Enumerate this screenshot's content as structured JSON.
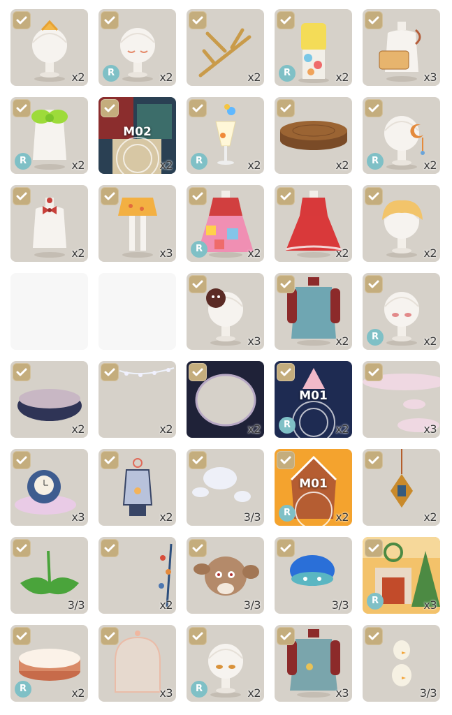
{
  "items": [
    {
      "id": "hair-clip-yellow",
      "count": "x2",
      "rare": false,
      "checked": true,
      "code": null
    },
    {
      "id": "head-eyes-closed",
      "count": "x2",
      "rare": true,
      "checked": true,
      "code": null
    },
    {
      "id": "golden-branch-rack",
      "count": "x2",
      "rare": false,
      "checked": true,
      "code": null
    },
    {
      "id": "yellow-outfit-balloons",
      "count": "x2",
      "rare": true,
      "checked": true,
      "code": null
    },
    {
      "id": "jam-tag-bust",
      "count": "x3",
      "rare": false,
      "checked": true,
      "code": null
    },
    {
      "id": "green-bow-top",
      "count": "x2",
      "rare": true,
      "checked": true,
      "code": null
    },
    {
      "id": "music-disc-m02",
      "count": "x2",
      "rare": false,
      "checked": true,
      "code": "M02"
    },
    {
      "id": "balloon-glass",
      "count": "x2",
      "rare": true,
      "checked": true,
      "code": null
    },
    {
      "id": "wood-stump-platform",
      "count": "x2",
      "rare": false,
      "checked": true,
      "code": null
    },
    {
      "id": "moon-earring-head",
      "count": "x2",
      "rare": true,
      "checked": true,
      "code": null
    },
    {
      "id": "red-bow-top",
      "count": "x2",
      "rare": false,
      "checked": true,
      "code": null
    },
    {
      "id": "yellow-skirt-tights",
      "count": "x3",
      "rare": false,
      "checked": true,
      "code": null
    },
    {
      "id": "patchwork-dress",
      "count": "x2",
      "rare": true,
      "checked": true,
      "code": null
    },
    {
      "id": "red-ruffle-dress",
      "count": "x2",
      "rare": false,
      "checked": true,
      "code": null
    },
    {
      "id": "fluffy-blonde-hair",
      "count": "x2",
      "rare": false,
      "checked": true,
      "code": null
    },
    {
      "id": "blank-1",
      "blank": true
    },
    {
      "id": "blank-2",
      "blank": true
    },
    {
      "id": "button-hairpin",
      "count": "x3",
      "rare": false,
      "checked": true,
      "code": null
    },
    {
      "id": "sweater-dress",
      "count": "x2",
      "rare": false,
      "checked": true,
      "code": null
    },
    {
      "id": "pink-eyes-head",
      "count": "x2",
      "rare": true,
      "checked": true,
      "code": null
    },
    {
      "id": "dark-cloud-floor",
      "count": "x2",
      "rare": false,
      "checked": true,
      "code": null
    },
    {
      "id": "crystal-garland",
      "count": "x2",
      "rare": false,
      "checked": true,
      "code": null
    },
    {
      "id": "dark-ring-frame",
      "count": "x2",
      "rare": false,
      "checked": true,
      "code": null
    },
    {
      "id": "music-disc-m01-blue",
      "count": "x2",
      "rare": true,
      "checked": true,
      "code": "M01"
    },
    {
      "id": "pink-clouds",
      "count": "x3",
      "rare": false,
      "checked": true,
      "code": null
    },
    {
      "id": "snow-globe-clock",
      "count": "x3",
      "rare": false,
      "checked": true,
      "code": null
    },
    {
      "id": "glass-lantern",
      "count": "x2",
      "rare": false,
      "checked": true,
      "code": null
    },
    {
      "id": "soap-bubbles",
      "count": "3/3",
      "rare": false,
      "checked": true,
      "code": null
    },
    {
      "id": "music-disc-m01-gingerbread",
      "count": "x2",
      "rare": true,
      "checked": true,
      "code": "M01"
    },
    {
      "id": "hanging-ornament",
      "count": "x2",
      "rare": false,
      "checked": true,
      "code": null
    },
    {
      "id": "green-leaf",
      "count": "3/3",
      "rare": false,
      "checked": true,
      "code": null
    },
    {
      "id": "berry-branch",
      "count": "x2",
      "rare": false,
      "checked": true,
      "code": null
    },
    {
      "id": "bunny-plush",
      "count": "3/3",
      "rare": false,
      "checked": true,
      "code": null
    },
    {
      "id": "blue-mushroom-hat",
      "count": "3/3",
      "rare": false,
      "checked": true,
      "code": null
    },
    {
      "id": "christmas-fireplace-room",
      "count": "x3",
      "rare": true,
      "checked": true,
      "code": null
    },
    {
      "id": "cream-cake",
      "count": "x2",
      "rare": true,
      "checked": true,
      "code": null
    },
    {
      "id": "glass-dome",
      "count": "x3",
      "rare": false,
      "checked": true,
      "code": null
    },
    {
      "id": "amber-eyes-head",
      "count": "x2",
      "rare": true,
      "checked": true,
      "code": null
    },
    {
      "id": "teal-sweater-dress",
      "count": "x3",
      "rare": false,
      "checked": true,
      "code": null
    },
    {
      "id": "snowman-chicks",
      "count": "3/3",
      "rare": false,
      "checked": true,
      "code": null
    }
  ],
  "badges": {
    "rare_letter": "R"
  },
  "colors": {
    "tile": "#d6d1c9",
    "check": "#c4ad7d",
    "rare": "#7fc0c6"
  }
}
